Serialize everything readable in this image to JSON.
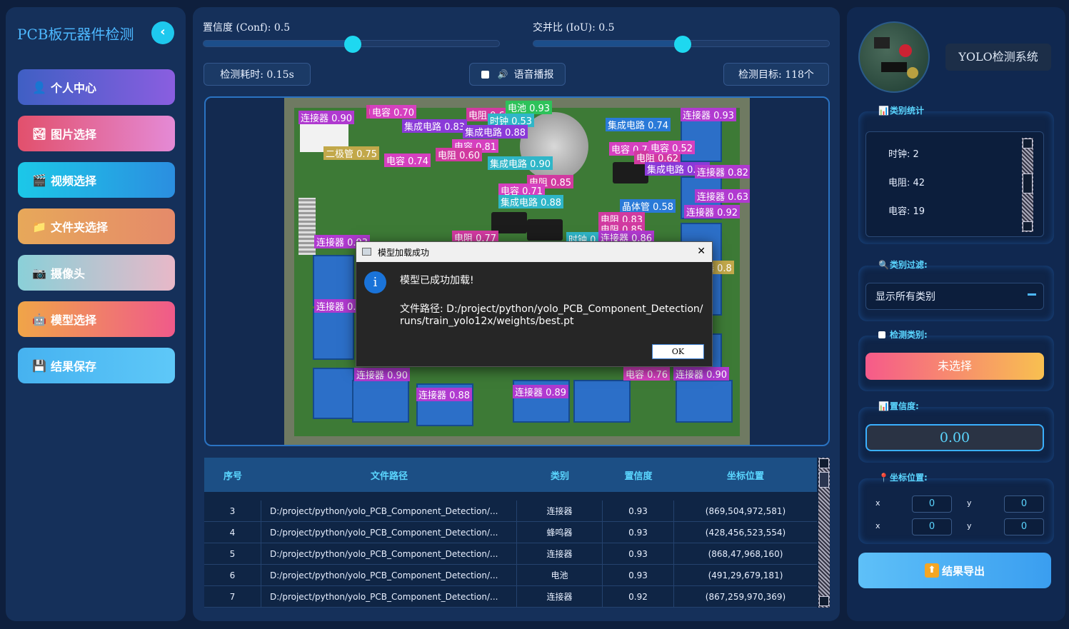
{
  "sidebar": {
    "title": "PCB板元器件检测",
    "collapse_icon": "‹",
    "items": [
      {
        "label": "个人中心",
        "icon": "👤",
        "colors": [
          "#3f5fc4",
          "#8a5ee0"
        ]
      },
      {
        "label": "图片选择",
        "icon": "🏞",
        "colors": [
          "#e2506c",
          "#e48ad6"
        ]
      },
      {
        "label": "视频选择",
        "icon": "🎬",
        "colors": [
          "#1cc8e8",
          "#2b8ee0"
        ]
      },
      {
        "label": "文件夹选择",
        "icon": "📁",
        "colors": [
          "#e7a85a",
          "#e58a6a"
        ]
      },
      {
        "label": "摄像头",
        "icon": "📷",
        "colors": [
          "#8ad0d8",
          "#e8b8c8"
        ]
      },
      {
        "label": "模型选择",
        "icon": "🤖",
        "colors": [
          "#f0a548",
          "#f05a8a"
        ]
      },
      {
        "label": "结果保存",
        "icon": "💾",
        "colors": [
          "#46b2f0",
          "#5ec8f8"
        ]
      }
    ]
  },
  "controls": {
    "conf_label": "置信度 (Conf): 0.5",
    "conf_value": 0.5,
    "iou_label": "交并比 (IoU): 0.5",
    "iou_value": 0.5,
    "time_label": "检测耗时: 0.15s",
    "voice_label": "语音播报",
    "targets_label": "检测目标: 118个"
  },
  "detection_labels": [
    {
      "text": "连接器 0.90",
      "color": "#b03ad0"
    },
    {
      "text": "电阻 0.78",
      "color": "#d13aa0"
    },
    {
      "text": "电阻 0.69",
      "color": "#d13aa0"
    },
    {
      "text": "电池 0.93",
      "color": "#2ec25a"
    },
    {
      "text": "时钟 0.53",
      "color": "#2fb6c8"
    },
    {
      "text": "电容 0.70",
      "color": "#d640c0"
    },
    {
      "text": "连接器 0.93",
      "color": "#b03ad0"
    },
    {
      "text": "集成电路 0.83",
      "color": "#8a3ad8"
    },
    {
      "text": "集成电路 0.88",
      "color": "#8a3ad8"
    },
    {
      "text": "集成电路 0.74",
      "color": "#2a7ad8"
    },
    {
      "text": "二极管 0.75",
      "color": "#c2a84a"
    },
    {
      "text": "电容 0.81",
      "color": "#d640c0"
    },
    {
      "text": "电容 0.74",
      "color": "#d640c0"
    },
    {
      "text": "电阻 0.60",
      "color": "#d13aa0"
    },
    {
      "text": "集成电路 0.90",
      "color": "#2fb6c8"
    },
    {
      "text": "电容 0.74",
      "color": "#d640c0"
    },
    {
      "text": "电阻 0.62",
      "color": "#d13aa0"
    },
    {
      "text": "电容 0.52",
      "color": "#d640c0"
    },
    {
      "text": "集成电路 0.89",
      "color": "#8a3ad8"
    },
    {
      "text": "连接器 0.82",
      "color": "#b03ad0"
    },
    {
      "text": "电阻 0.85",
      "color": "#d13aa0"
    },
    {
      "text": "电容 0.71",
      "color": "#d640c0"
    },
    {
      "text": "集成电路 0.88",
      "color": "#2fb6c8"
    },
    {
      "text": "连接器 0.63",
      "color": "#b03ad0"
    },
    {
      "text": "晶体管 0.58",
      "color": "#2a7ad8"
    },
    {
      "text": "连接器 0.92",
      "color": "#b03ad0"
    },
    {
      "text": "电阻 0.83",
      "color": "#d13aa0"
    },
    {
      "text": "电阻 0.85",
      "color": "#d13aa0"
    },
    {
      "text": "电阻 0.77",
      "color": "#d13aa0"
    },
    {
      "text": "时钟 0.8",
      "color": "#2fb6c8"
    },
    {
      "text": "连接器 0.86",
      "color": "#b03ad0"
    },
    {
      "text": "连接器 0.93",
      "color": "#b03ad0"
    },
    {
      "text": "连接器 0.9",
      "color": "#b03ad0"
    },
    {
      "text": "连接器 0.90",
      "color": "#b03ad0"
    },
    {
      "text": "连接器 0.88",
      "color": "#b03ad0"
    },
    {
      "text": "连接器 0.89",
      "color": "#b03ad0"
    },
    {
      "text": "电容 0.76",
      "color": "#d640c0"
    },
    {
      "text": "连接器 0.90",
      "color": "#b03ad0"
    },
    {
      "text": "连接器 0.8",
      "color": "#c2a84a"
    }
  ],
  "dialog": {
    "title": "模型加载成功",
    "message": "模型已成功加载!",
    "path_line1": "文件路径: D:/project/python/yolo_PCB_Component_Detection/",
    "path_line2": "runs/train_yolo12x/weights/best.pt",
    "ok_label": "OK",
    "close_icon": "✕",
    "info_icon": "i"
  },
  "table": {
    "headers": [
      "序号",
      "文件路径",
      "类别",
      "置信度",
      "坐标位置"
    ],
    "rows": [
      [
        "3",
        "D:/project/python/yolo_PCB_Component_Detection/...",
        "连接器",
        "0.93",
        "(869,504,972,581)"
      ],
      [
        "4",
        "D:/project/python/yolo_PCB_Component_Detection/...",
        "蜂鸣器",
        "0.93",
        "(428,456,523,554)"
      ],
      [
        "5",
        "D:/project/python/yolo_PCB_Component_Detection/...",
        "连接器",
        "0.93",
        "(868,47,968,160)"
      ],
      [
        "6",
        "D:/project/python/yolo_PCB_Component_Detection/...",
        "电池",
        "0.93",
        "(491,29,679,181)"
      ],
      [
        "7",
        "D:/project/python/yolo_PCB_Component_Detection/...",
        "连接器",
        "0.92",
        "(867,259,970,369)"
      ]
    ]
  },
  "right": {
    "system_title": "YOLO检测系统",
    "stats_title": "类别统计",
    "stats": [
      "时钟: 2",
      "电阻: 42",
      "电容: 19"
    ],
    "filter_title": "类别过滤:",
    "filter_value": "显示所有类别",
    "detect_class_title": "检测类别:",
    "detect_class_value": "未选择",
    "conf_title": "置信度:",
    "conf_value": "0.00",
    "coord_title": "坐标位置:",
    "coords": [
      {
        "label": "x",
        "value": "0"
      },
      {
        "label": "y",
        "value": "0"
      },
      {
        "label": "x",
        "value": "0"
      },
      {
        "label": "y",
        "value": "0"
      }
    ],
    "export_label": "结果导出",
    "export_icon": "⬆"
  }
}
